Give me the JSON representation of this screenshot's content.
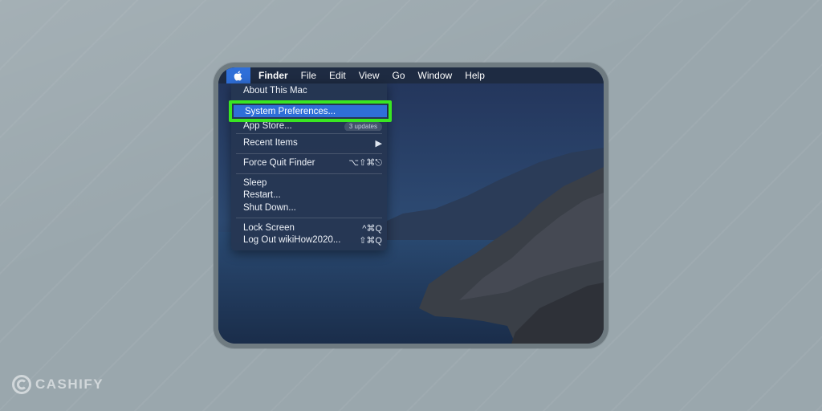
{
  "menubar": {
    "apple_icon": "apple-icon",
    "items": [
      "Finder",
      "File",
      "Edit",
      "View",
      "Go",
      "Window",
      "Help"
    ]
  },
  "apple_menu": {
    "about": "About This Mac",
    "system_preferences": "System Preferences...",
    "app_store": "App Store...",
    "app_store_badge": "3 updates",
    "recent_items": "Recent Items",
    "recent_items_arrow": "▶",
    "force_quit": "Force Quit Finder",
    "force_quit_shortcut": "⌥⇧⌘⎋",
    "sleep": "Sleep",
    "restart": "Restart...",
    "shut_down": "Shut Down...",
    "lock_screen": "Lock Screen",
    "lock_screen_shortcut": "^⌘Q",
    "log_out": "Log Out wikiHow2020...",
    "log_out_shortcut": "⇧⌘Q"
  },
  "highlight": {
    "color": "#39e622",
    "target": "System Preferences..."
  },
  "watermark": {
    "text": "CASHIFY"
  },
  "colors": {
    "accent": "#2f6fd8",
    "background": "#9aa7ad",
    "frame": "#6f7b81"
  }
}
